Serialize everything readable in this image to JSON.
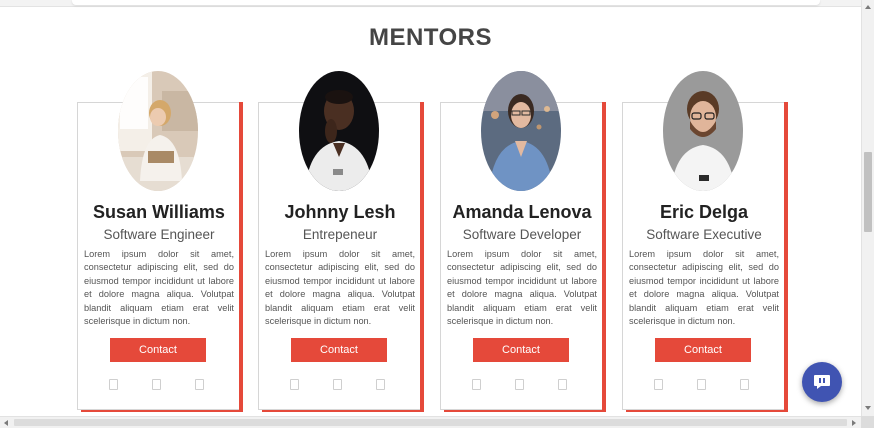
{
  "section": {
    "title": "MENTORS"
  },
  "mentors": [
    {
      "name": "Susan Williams",
      "role": "Software Engineer",
      "bio": "Lorem ipsum dolor sit amet, consectetur adipiscing elit, sed do eiusmod tempor incididunt ut labore et dolore magna aliqua. Volutpat blandit aliquam etiam erat velit scelerisque in dictum non.",
      "contact_label": "Contact",
      "photo": "woman-reading-photo"
    },
    {
      "name": "Johnny Lesh",
      "role": "Entrepeneur",
      "bio": "Lorem ipsum dolor sit amet, consectetur adipiscing elit, sed do eiusmod tempor incididunt ut labore et dolore magna aliqua. Volutpat blandit aliquam etiam erat velit scelerisque in dictum non.",
      "contact_label": "Contact",
      "photo": "man-thinking-photo"
    },
    {
      "name": "Amanda Lenova",
      "role": "Software Developer",
      "bio": "Lorem ipsum dolor sit amet, consectetur adipiscing elit, sed do eiusmod tempor incididunt ut labore et dolore magna aliqua. Volutpat blandit aliquam etiam erat velit scelerisque in dictum non.",
      "contact_label": "Contact",
      "photo": "woman-glasses-photo"
    },
    {
      "name": "Eric Delga",
      "role": "Software Executive",
      "bio": "Lorem ipsum dolor sit amet, consectetur adipiscing elit, sed do eiusmod tempor incididunt ut labore et dolore magna aliqua. Volutpat blandit aliquam etiam erat velit scelerisque in dictum non.",
      "contact_label": "Contact",
      "photo": "man-beard-photo"
    }
  ],
  "social_icons": [
    "social-icon-1",
    "social-icon-2",
    "social-icon-3"
  ],
  "chat": {
    "icon": "chat-bubble-icon"
  },
  "colors": {
    "accent": "#e5493a",
    "title": "#454545",
    "name": "#222222",
    "text": "#555555",
    "chat": "#4054b2"
  }
}
